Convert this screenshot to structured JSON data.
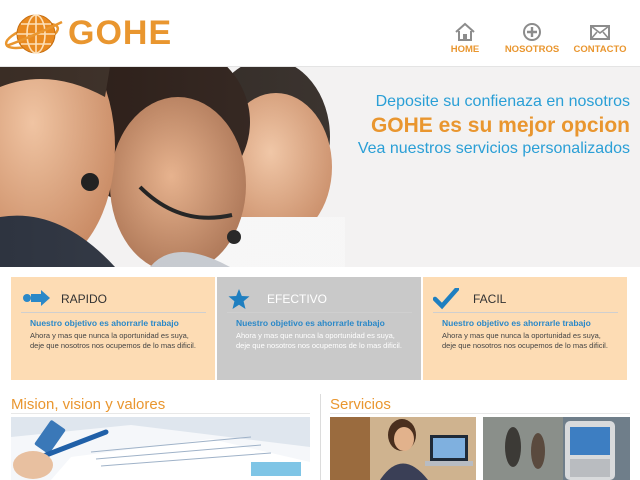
{
  "brand": {
    "name": "GOHE"
  },
  "nav": [
    {
      "label": "HOME",
      "icon": "home-icon"
    },
    {
      "label": "NOSOTROS",
      "icon": "plus-circle-icon"
    },
    {
      "label": "CONTACTO",
      "icon": "envelope-icon"
    }
  ],
  "hero": {
    "line1": "Deposite su confienaza en nosotros",
    "line2": "GOHE es su mejor opcion",
    "line3": "Vea nuestros servicios personalizados"
  },
  "features": [
    {
      "title": "RAPIDO",
      "icon": "arrow-right-icon",
      "subtitle": "Nuestro objetivo es ahorrarle trabajo",
      "body": "Ahora y mas que nunca la oportunidad es suya, deje que nosotros nos ocupemos de lo mas dificil.",
      "bg": "#fddcb4"
    },
    {
      "title": "EFECTIVO",
      "icon": "star-icon",
      "subtitle": "Nuestro objetivo es ahorrarle trabajo",
      "body": "Ahora y mas que nunca la oportunidad es suya, deje que nosotros nos ocupemos de lo mas dificil.",
      "bg": "#c9c9c9"
    },
    {
      "title": "FACIL",
      "icon": "checkmark-icon",
      "subtitle": "Nuestro objetivo es ahorrarle trabajo",
      "body": "Ahora y mas que nunca la oportunidad es suya, deje que nosotros nos ocupemos de lo mas dificil.",
      "bg": "#fddcb4"
    }
  ],
  "sections": {
    "left_title": "Mision, vision y valores",
    "right_title": "Servicios"
  },
  "colors": {
    "accent": "#e9962f",
    "blue": "#2a9fd6"
  }
}
